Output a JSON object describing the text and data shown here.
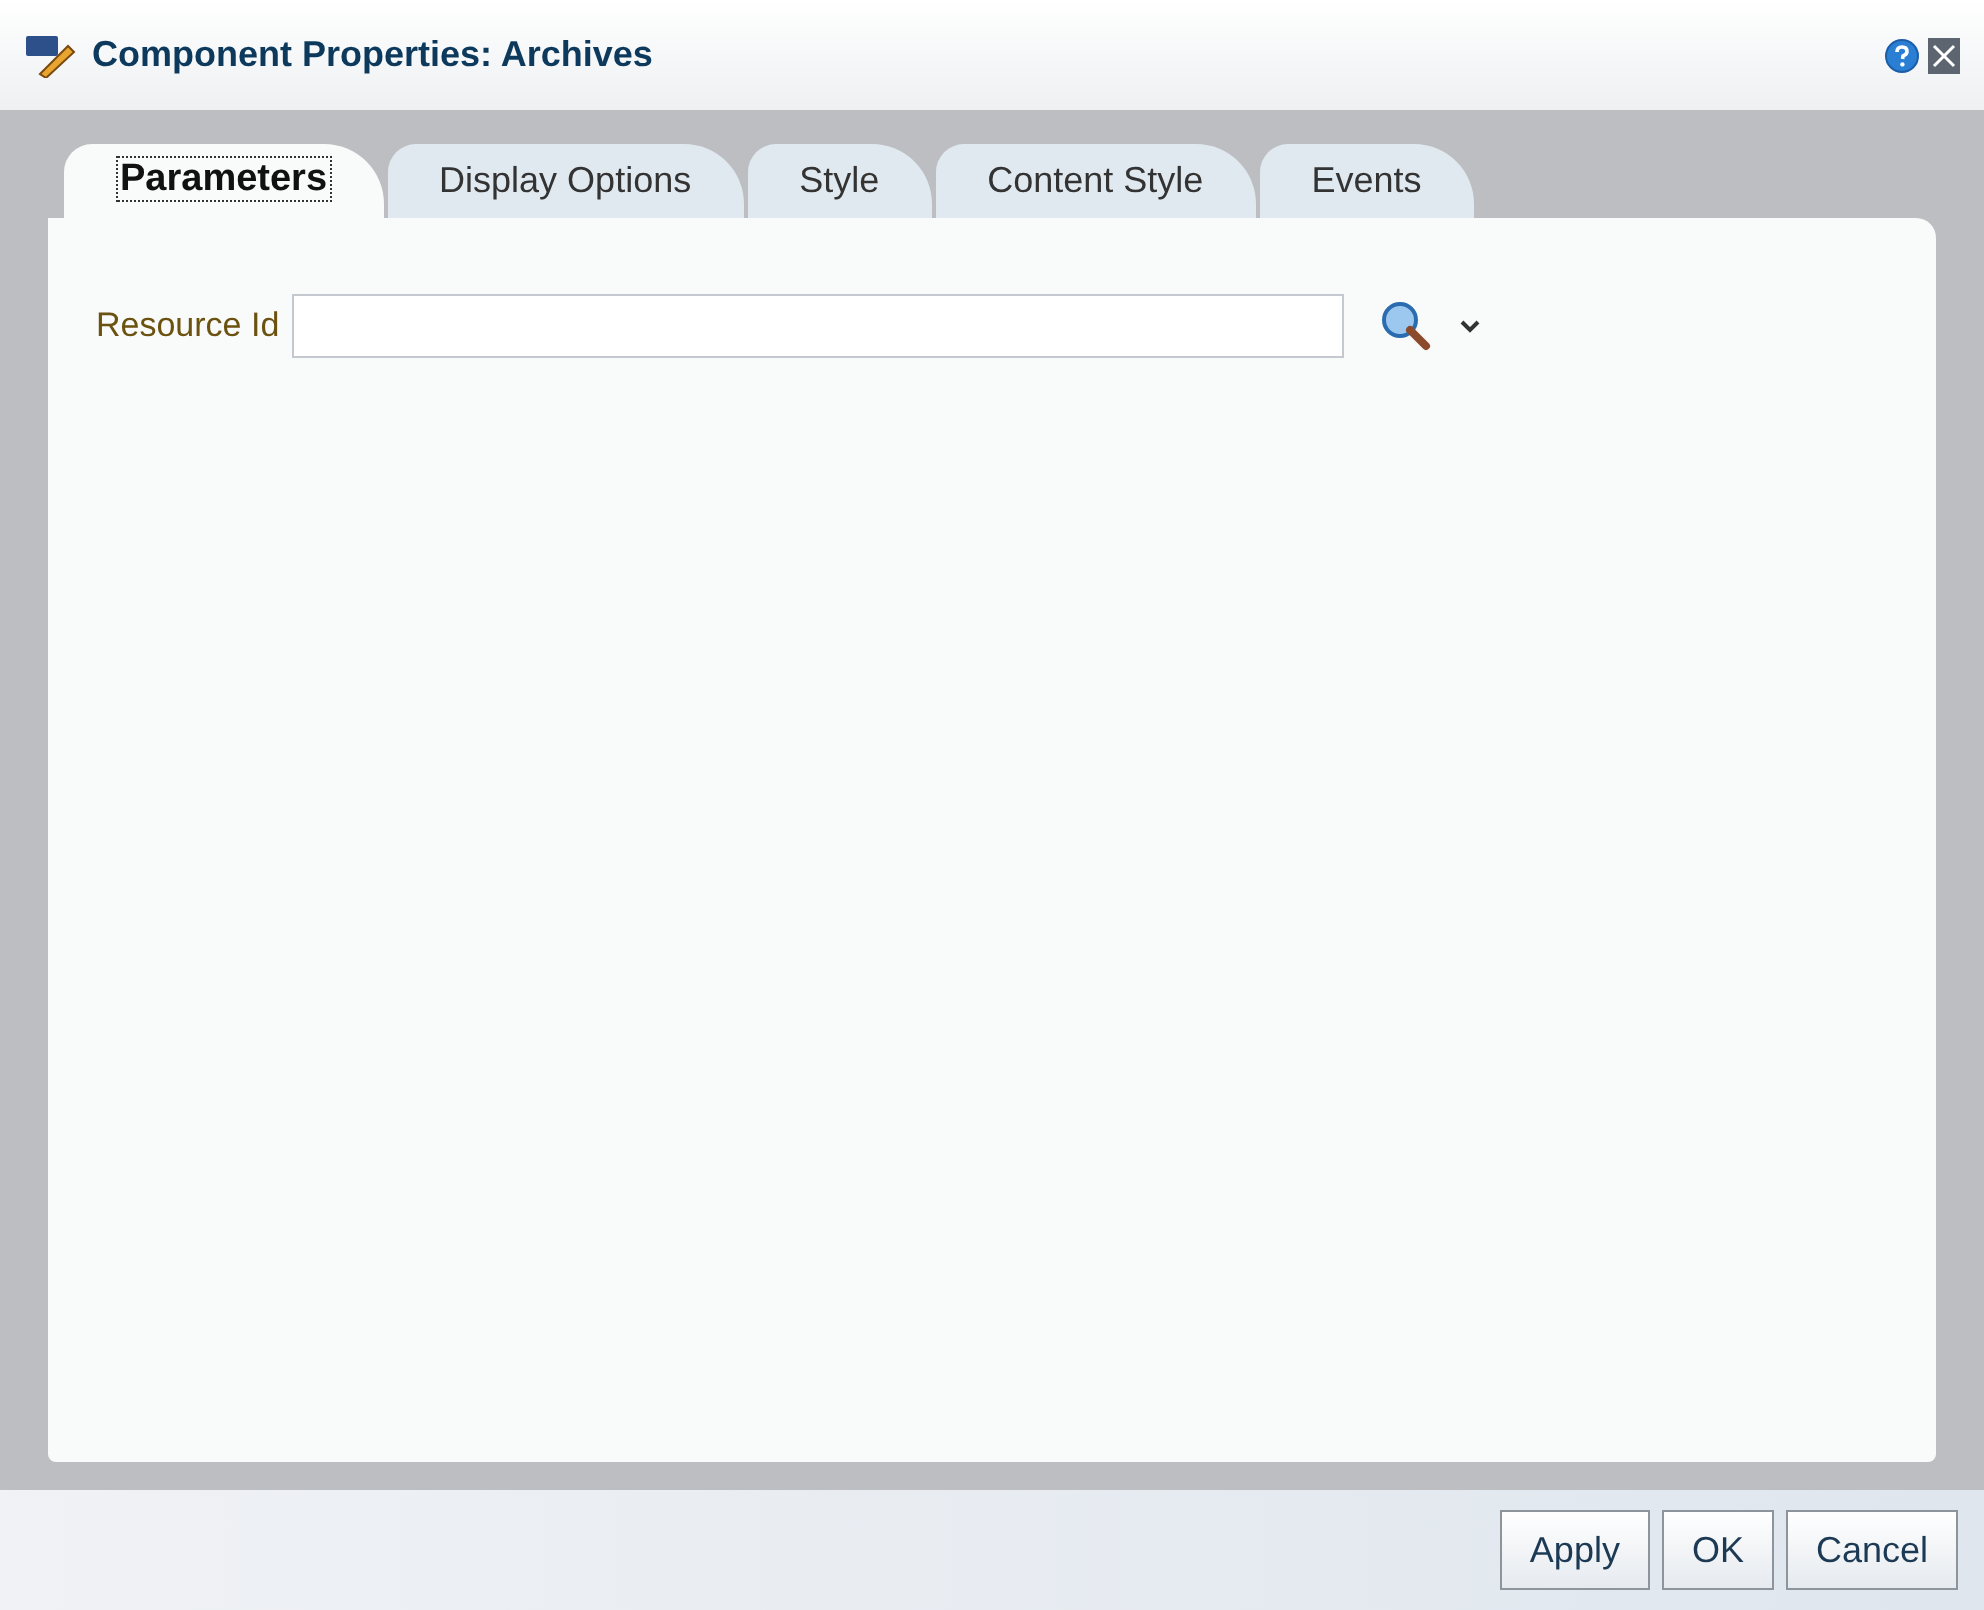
{
  "window": {
    "title": "Component Properties: Archives"
  },
  "tabs": [
    {
      "label": "Parameters",
      "selected": true
    },
    {
      "label": "Display Options",
      "selected": false
    },
    {
      "label": "Style",
      "selected": false
    },
    {
      "label": "Content Style",
      "selected": false
    },
    {
      "label": "Events",
      "selected": false
    }
  ],
  "fields": [
    {
      "label": "Resource Id"
    }
  ],
  "buttons": [
    "Apply",
    "OK",
    "Cancel"
  ]
}
